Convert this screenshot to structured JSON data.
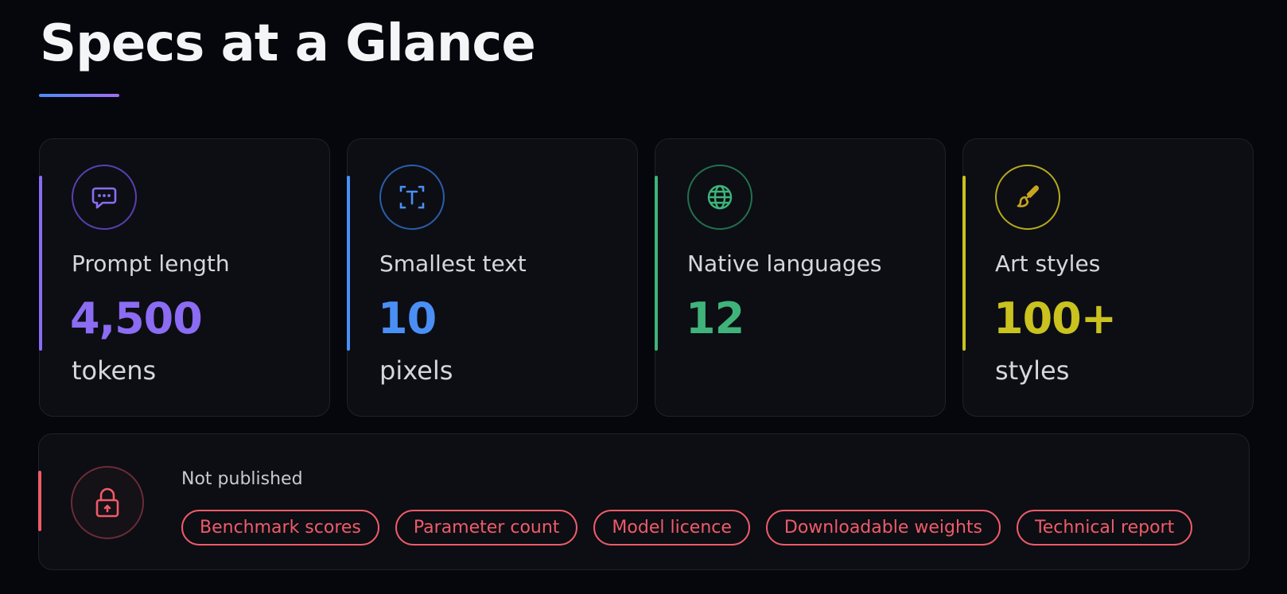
{
  "page": {
    "title": "Specs at a Glance"
  },
  "cards": [
    {
      "label": "Prompt length",
      "value": "4,500",
      "unit": "tokens",
      "icon": "chat-bubble-icon",
      "color": "#8b6cf2"
    },
    {
      "label": "Smallest text",
      "value": "10",
      "unit": "pixels",
      "icon": "text-scan-icon",
      "color": "#4a8ff5"
    },
    {
      "label": "Native languages",
      "value": "12",
      "unit": "",
      "icon": "globe-icon",
      "color": "#3fb37a"
    },
    {
      "label": "Art styles",
      "value": "100+",
      "unit": "styles",
      "icon": "paintbrush-icon",
      "color": "#c9c21f"
    }
  ],
  "unpublished": {
    "heading": "Not published",
    "icon": "lock-icon",
    "color": "#ef5b68",
    "items": [
      "Benchmark scores",
      "Parameter count",
      "Model licence",
      "Downloadable weights",
      "Technical report"
    ]
  }
}
